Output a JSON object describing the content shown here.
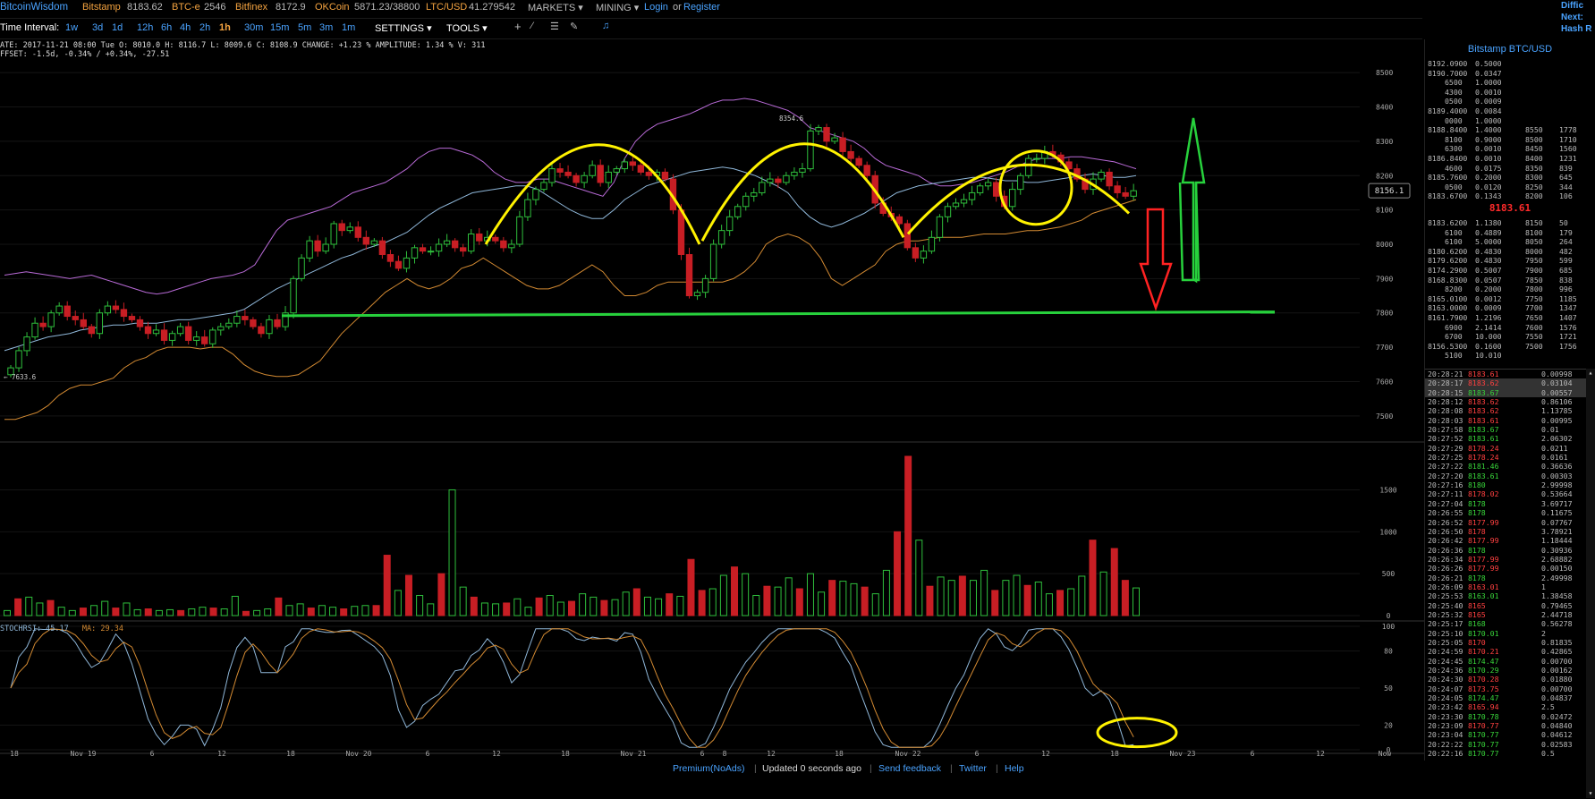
{
  "topbar": {
    "brand": "BitcoinWisdom",
    "tickers": [
      {
        "exchange": "Bitstamp",
        "price": "8183.62"
      },
      {
        "exchange": "BTC-e",
        "price": "2546"
      },
      {
        "exchange": "Bitfinex",
        "price": "8172.9"
      },
      {
        "exchange": "OKCoin",
        "price": "5871.23/38800"
      },
      {
        "exchange": "LTC/USD",
        "price": "41.279542"
      }
    ],
    "markets": "MARKETS",
    "mining": "MINING",
    "login": "Login",
    "or": "or",
    "register": "Register",
    "corner_lines": [
      "Diffic",
      "Next:",
      "Hash R"
    ]
  },
  "toolbar": {
    "label": "Time Interval:",
    "intervals": [
      "1w",
      "3d",
      "1d",
      "12h",
      "6h",
      "4h",
      "2h",
      "1h",
      "30m",
      "15m",
      "5m",
      "3m",
      "1m"
    ],
    "active": "1h",
    "settings": "SETTINGS",
    "tools": "TOOLS",
    "icons": [
      "plus-icon",
      "line-icon",
      "lines-icon",
      "brush-icon",
      "bell-icon"
    ]
  },
  "info": {
    "line1": "ATE: 2017-11-21 08:00 Tue   O: 8010.0   H: 8116.7   L: 8009.6   C: 8108.9   CHANGE: +1.23 %   AMPLITUDE: 1.34 %   V: 311",
    "line2": "FFSET: -1.5d, -0.34% / +0.34%, -27.51"
  },
  "chart_data": {
    "type": "candlestick",
    "price_axis": {
      "ylim": [
        7450,
        8550
      ],
      "ticks": [
        8500,
        8400,
        8300,
        8200,
        8100,
        8000,
        7900,
        7800,
        7700,
        7600,
        7500
      ]
    },
    "volume_axis": {
      "ylim": [
        0,
        1900
      ],
      "ticks": [
        1500,
        1000,
        500,
        0
      ]
    },
    "rsi_axis": {
      "ylim": [
        0,
        100
      ],
      "ticks": [
        100,
        80,
        50,
        20,
        0
      ],
      "label": "STOCHRSI: 45.17",
      "ma_label": "MA: 29.34"
    },
    "x_ticks": [
      "18",
      "Nov 19",
      "6",
      "12",
      "18",
      "Nov 20",
      "6",
      "12",
      "18",
      "Nov 21",
      "6",
      "8",
      "12",
      "18",
      "Nov 22",
      "6",
      "12",
      "18",
      "Nov 23",
      "6",
      "12",
      "Now"
    ],
    "current_price_label": "8156.1",
    "high_label": "8354.6",
    "low_label": "7633.6",
    "close": [
      7640,
      7690,
      7730,
      7770,
      7760,
      7800,
      7820,
      7790,
      7780,
      7760,
      7740,
      7800,
      7820,
      7810,
      7790,
      7780,
      7760,
      7740,
      7750,
      7720,
      7740,
      7760,
      7720,
      7730,
      7710,
      7750,
      7760,
      7770,
      7790,
      7780,
      7760,
      7740,
      7780,
      7760,
      7800,
      7900,
      7960,
      8010,
      7980,
      8000,
      8060,
      8040,
      8050,
      8020,
      8000,
      8010,
      7970,
      7950,
      7930,
      7960,
      7990,
      7980,
      7980,
      8000,
      8010,
      7990,
      7980,
      8030,
      8010,
      8020,
      8010,
      7990,
      8000,
      8080,
      8130,
      8160,
      8180,
      8220,
      8210,
      8200,
      8180,
      8200,
      8230,
      8180,
      8210,
      8220,
      8240,
      8230,
      8210,
      8200,
      8210,
      8190,
      8100,
      7970,
      7850,
      7860,
      7900,
      8000,
      8040,
      8080,
      8110,
      8140,
      8150,
      8180,
      8190,
      8180,
      8200,
      8210,
      8220,
      8330,
      8340,
      8300,
      8310,
      8270,
      8250,
      8230,
      8200,
      8120,
      8090,
      8080,
      8060,
      7990,
      7960,
      7980,
      8020,
      8080,
      8110,
      8120,
      8130,
      8150,
      8170,
      8180,
      8140,
      8110,
      8160,
      8200,
      8250,
      8250,
      8270,
      8260,
      8240,
      8220,
      8190,
      8160,
      8190,
      8210,
      8170,
      8150,
      8140,
      8156
    ],
    "bands": {
      "upper": [
        7910,
        7915,
        7920,
        7915,
        7910,
        7905,
        7900,
        7905,
        7910,
        7900,
        7890,
        7880,
        7870,
        7860,
        7855,
        7860,
        7870,
        7880,
        7890,
        7900,
        7905,
        7910,
        7920,
        7940,
        7990,
        8040,
        8070,
        8080,
        8090,
        8100,
        8110,
        8130,
        8150,
        8160,
        8170,
        8180,
        8200,
        8220,
        8250,
        8270,
        8280,
        8280,
        8270,
        8260,
        8240,
        8210,
        8190,
        8180,
        8180,
        8190,
        8190,
        8180,
        8170,
        8160,
        8150,
        8140,
        8180,
        8250,
        8300,
        8330,
        8350,
        8360,
        8370,
        8380,
        8395,
        8410,
        8420,
        8420,
        8425,
        8420,
        8410,
        8400,
        8390,
        8370,
        8340,
        8330,
        8320,
        8310,
        8300,
        8280,
        8250,
        8230,
        8220,
        8210,
        8200,
        8180,
        8170,
        8170,
        8175,
        8180,
        8190,
        8200,
        8210,
        8225,
        8240,
        8250,
        8250,
        8250,
        8255,
        8255,
        8250,
        8245,
        8240,
        8230,
        8220
      ],
      "middle": [
        7690,
        7700,
        7710,
        7720,
        7730,
        7735,
        7740,
        7750,
        7755,
        7760,
        7765,
        7765,
        7770,
        7770,
        7770,
        7775,
        7780,
        7780,
        7785,
        7790,
        7795,
        7800,
        7810,
        7830,
        7850,
        7870,
        7885,
        7900,
        7915,
        7930,
        7945,
        7960,
        7970,
        7985,
        7995,
        8005,
        8020,
        8035,
        8060,
        8085,
        8105,
        8120,
        8135,
        8150,
        8155,
        8160,
        8165,
        8170,
        8170,
        8160,
        8140,
        8120,
        8100,
        8085,
        8075,
        8075,
        8100,
        8130,
        8150,
        8170,
        8180,
        8190,
        8200,
        8210,
        8215,
        8220,
        8225,
        8220,
        8210,
        8200,
        8185,
        8170,
        8150,
        8110,
        8080,
        8060,
        8050,
        8060,
        8075,
        8090,
        8110,
        8130,
        8150,
        8160,
        8170,
        8175,
        8180,
        8185,
        8190,
        8195,
        8195,
        8190,
        8185,
        8185,
        8180,
        8180,
        8185,
        8190,
        8195,
        8200,
        8205,
        8200,
        8195,
        8195,
        8200
      ],
      "lower": [
        7490,
        7490,
        7500,
        7510,
        7530,
        7560,
        7580,
        7590,
        7590,
        7600,
        7610,
        7640,
        7660,
        7670,
        7690,
        7700,
        7700,
        7700,
        7695,
        7700,
        7700,
        7680,
        7650,
        7630,
        7620,
        7615,
        7615,
        7620,
        7640,
        7660,
        7700,
        7740,
        7770,
        7800,
        7830,
        7860,
        7880,
        7900,
        7880,
        7870,
        7880,
        7900,
        7930,
        7940,
        7960,
        7940,
        7920,
        7900,
        7880,
        7870,
        7870,
        7880,
        7900,
        7920,
        7940,
        7920,
        7880,
        7850,
        7850,
        7860,
        7880,
        7890,
        7890,
        7890,
        7890,
        7890,
        7890,
        7900,
        7920,
        7950,
        8000,
        8020,
        8030,
        8020,
        8000,
        7960,
        7900,
        7880,
        7900,
        7920,
        7940,
        7980,
        8000,
        8010,
        8010,
        8015,
        8020,
        8020,
        8020,
        8025,
        8030,
        8030,
        8030,
        8035,
        8040,
        8040,
        8045,
        8050,
        8060,
        8070,
        8090,
        8100,
        8110,
        8120,
        8130
      ]
    },
    "volume": [
      60,
      200,
      220,
      150,
      180,
      100,
      60,
      90,
      120,
      170,
      90,
      150,
      70,
      80,
      60,
      70,
      60,
      80,
      100,
      90,
      80,
      230,
      50,
      60,
      80,
      210,
      120,
      140,
      90,
      120,
      100,
      80,
      110,
      120,
      120,
      720,
      300,
      480,
      240,
      140,
      500,
      1500,
      340,
      220,
      150,
      140,
      150,
      200,
      100,
      210,
      240,
      160,
      170,
      260,
      220,
      180,
      190,
      280,
      320,
      220,
      200,
      260,
      230,
      670,
      300,
      320,
      480,
      580,
      500,
      240,
      350,
      340,
      450,
      320,
      500,
      280,
      420,
      410,
      380,
      340,
      260,
      540,
      1000,
      1900,
      900,
      350,
      460,
      420,
      470,
      420,
      540,
      300,
      420,
      480,
      360,
      400,
      260,
      300,
      320,
      470,
      900,
      520,
      800,
      420,
      330
    ],
    "annotations": [
      {
        "shape": "arc",
        "color": "yellow"
      },
      {
        "shape": "arc",
        "color": "yellow"
      },
      {
        "shape": "arc",
        "color": "yellow"
      },
      {
        "shape": "circle",
        "color": "yellow"
      },
      {
        "shape": "ellipse",
        "color": "yellow"
      },
      {
        "shape": "horizontal-line",
        "color": "green",
        "y": 7795
      },
      {
        "shape": "arrow-down",
        "color": "red"
      },
      {
        "shape": "arrow-up-down",
        "color": "green"
      }
    ]
  },
  "orderbook": {
    "title": "Bitstamp BTC/USD",
    "last_price": "8183.61",
    "asks": [
      [
        "8192.0900",
        "0.5000",
        "",
        ""
      ],
      [
        "8190.7000",
        "0.0347",
        "",
        ""
      ],
      [
        "6500",
        "1.0000",
        "",
        ""
      ],
      [
        "4300",
        "0.0010",
        "",
        ""
      ],
      [
        "0500",
        "0.0009",
        "",
        ""
      ],
      [
        "8189.4000",
        "0.0084",
        "",
        ""
      ],
      [
        "0000",
        "1.0000",
        "",
        ""
      ],
      [
        "8188.8400",
        "1.4000",
        "8550",
        "1778"
      ],
      [
        "8100",
        "0.9000",
        "8500",
        "1710"
      ],
      [
        "6300",
        "0.0010",
        "8450",
        "1560"
      ],
      [
        "8186.8400",
        "0.0010",
        "8400",
        "1231"
      ],
      [
        "4600",
        "0.0175",
        "8350",
        "839"
      ],
      [
        "8185.7600",
        "0.2000",
        "8300",
        "645"
      ],
      [
        "0500",
        "0.0120",
        "8250",
        "344"
      ],
      [
        "8183.6700",
        "0.1343",
        "8200",
        "106"
      ]
    ],
    "bids": [
      [
        "8183.6200",
        "1.1380",
        "8150",
        "50"
      ],
      [
        "6100",
        "0.4889",
        "8100",
        "179"
      ],
      [
        "6100",
        "5.0000",
        "8050",
        "264"
      ],
      [
        "8180.6200",
        "0.4830",
        "8000",
        "482"
      ],
      [
        "8179.6200",
        "0.4830",
        "7950",
        "599"
      ],
      [
        "8174.2900",
        "0.5007",
        "7900",
        "685"
      ],
      [
        "8168.8300",
        "0.0507",
        "7850",
        "838"
      ],
      [
        "8200",
        "0.2000",
        "7800",
        "996"
      ],
      [
        "8165.0100",
        "0.0012",
        "7750",
        "1185"
      ],
      [
        "8163.0000",
        "0.0009",
        "7700",
        "1347"
      ],
      [
        "8161.7900",
        "1.2196",
        "7650",
        "1407"
      ],
      [
        "6900",
        "2.1414",
        "7600",
        "1576"
      ],
      [
        "6700",
        "10.000",
        "7550",
        "1721"
      ],
      [
        "8156.5300",
        "0.1600",
        "7500",
        "1756"
      ],
      [
        "5100",
        "10.010",
        "",
        ""
      ]
    ]
  },
  "trades": [
    [
      "20:28:21",
      "8183.61",
      "0.00998",
      "r"
    ],
    [
      "20:28:17",
      "8183.62",
      "0.03104",
      "r"
    ],
    [
      "20:28:15",
      "8183.67",
      "0.00557",
      "g"
    ],
    [
      "20:28:12",
      "8183.62",
      "0.86106",
      "r"
    ],
    [
      "20:28:08",
      "8183.62",
      "1.13785",
      "r"
    ],
    [
      "20:28:03",
      "8183.61",
      "0.00995",
      "r"
    ],
    [
      "20:27:58",
      "8183.67",
      "0.01",
      "g"
    ],
    [
      "20:27:52",
      "8183.61",
      "2.06302",
      "g"
    ],
    [
      "20:27:29",
      "8178.24",
      "0.0211",
      "r"
    ],
    [
      "20:27:25",
      "8178.24",
      "0.0161",
      "r"
    ],
    [
      "20:27:22",
      "8181.46",
      "0.36636",
      "g"
    ],
    [
      "20:27:20",
      "8183.61",
      "0.00303",
      "g"
    ],
    [
      "20:27:16",
      "8180",
      "2.99998",
      "g"
    ],
    [
      "20:27:11",
      "8178.02",
      "0.53664",
      "r"
    ],
    [
      "20:27:04",
      "8178",
      "3.69717",
      "g"
    ],
    [
      "20:26:55",
      "8178",
      "0.11675",
      "g"
    ],
    [
      "20:26:52",
      "8177.99",
      "0.07767",
      "r"
    ],
    [
      "20:26:50",
      "8178",
      "3.78921",
      "r"
    ],
    [
      "20:26:42",
      "8177.99",
      "1.18444",
      "r"
    ],
    [
      "20:26:36",
      "8178",
      "0.30936",
      "g"
    ],
    [
      "20:26:34",
      "8177.99",
      "2.68882",
      "r"
    ],
    [
      "20:26:26",
      "8177.99",
      "0.00150",
      "r"
    ],
    [
      "20:26:21",
      "8178",
      "2.49998",
      "g"
    ],
    [
      "20:26:09",
      "8163.01",
      "1",
      "r"
    ],
    [
      "20:25:53",
      "8163.01",
      "1.38458",
      "g"
    ],
    [
      "20:25:40",
      "8165",
      "0.79465",
      "r"
    ],
    [
      "20:25:32",
      "8165",
      "2.44718",
      "r"
    ],
    [
      "20:25:17",
      "8168",
      "0.56278",
      "g"
    ],
    [
      "20:25:10",
      "8170.01",
      "2",
      "g"
    ],
    [
      "20:25:05",
      "8170",
      "0.81835",
      "r"
    ],
    [
      "20:24:59",
      "8170.21",
      "0.42865",
      "r"
    ],
    [
      "20:24:45",
      "8174.47",
      "0.00700",
      "g"
    ],
    [
      "20:24:36",
      "8170.29",
      "0.00162",
      "g"
    ],
    [
      "20:24:30",
      "8170.28",
      "0.01880",
      "r"
    ],
    [
      "20:24:07",
      "8173.75",
      "0.00700",
      "r"
    ],
    [
      "20:24:05",
      "8174.47",
      "0.04837",
      "g"
    ],
    [
      "20:23:42",
      "8165.94",
      "2.5",
      "r"
    ],
    [
      "20:23:30",
      "8170.78",
      "0.02472",
      "g"
    ],
    [
      "20:23:09",
      "8170.77",
      "0.04840",
      "r"
    ],
    [
      "20:23:04",
      "8170.77",
      "0.04612",
      "g"
    ],
    [
      "20:22:22",
      "8170.77",
      "0.02583",
      "g"
    ],
    [
      "20:22:16",
      "8170.77",
      "0.5",
      "g"
    ]
  ],
  "footer": {
    "premium": "Premium(NoAds)",
    "updated": "Updated 0 seconds ago",
    "feedback": "Send feedback",
    "twitter": "Twitter",
    "help": "Help"
  },
  "colors": {
    "up": "#2fbf3c",
    "down": "#c81e24",
    "band_upper": "#b86ad6",
    "band_middle": "#8fb7d9",
    "band_lower": "#d38a32",
    "draw_yellow": "#fff200",
    "draw_green": "#27d13c",
    "draw_red": "#ff2222"
  }
}
